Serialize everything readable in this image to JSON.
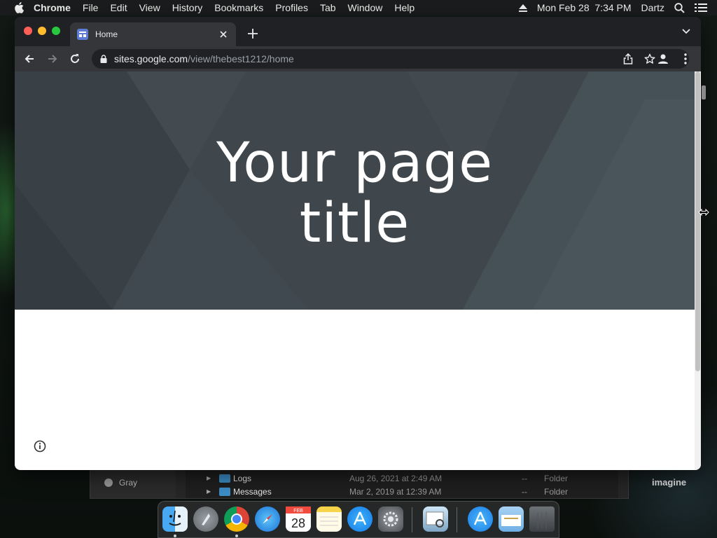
{
  "menubar": {
    "app_name": "Chrome",
    "items": [
      "File",
      "Edit",
      "View",
      "History",
      "Bookmarks",
      "Profiles",
      "Tab",
      "Window",
      "Help"
    ],
    "datetime": "Mon Feb 28  7:34 PM",
    "user": "Dartz"
  },
  "browser": {
    "tab_title": "Home",
    "url_host": "sites.google.com",
    "url_path": "/view/thebest1212/home"
  },
  "page": {
    "hero_title_line1": "Your page",
    "hero_title_line2": "title"
  },
  "finder": {
    "sidebar_tag": "Gray",
    "rows": [
      {
        "name": "Logs",
        "date": "Aug 26, 2021 at 2:49 AM",
        "size": "--",
        "kind": "Folder"
      },
      {
        "name": "Messages",
        "date": "Mar 2, 2019 at 12:39 AM",
        "size": "--",
        "kind": "Folder"
      }
    ]
  },
  "desktop": {
    "label": "imagine"
  },
  "dock": {
    "apps": [
      "finder-icon",
      "launchpad-icon",
      "chrome-icon",
      "safari-icon",
      "calendar-icon",
      "notes-icon",
      "app-store-icon",
      "system-preferences-icon",
      "preview-icon",
      "applications-folder-icon",
      "documents-folder-icon",
      "trash-icon"
    ],
    "calendar_month": "FEB",
    "calendar_day": "28"
  },
  "colors": {
    "hero_bg": "#3f474d",
    "chrome_dark": "#202124",
    "toolbar": "#35363a"
  }
}
